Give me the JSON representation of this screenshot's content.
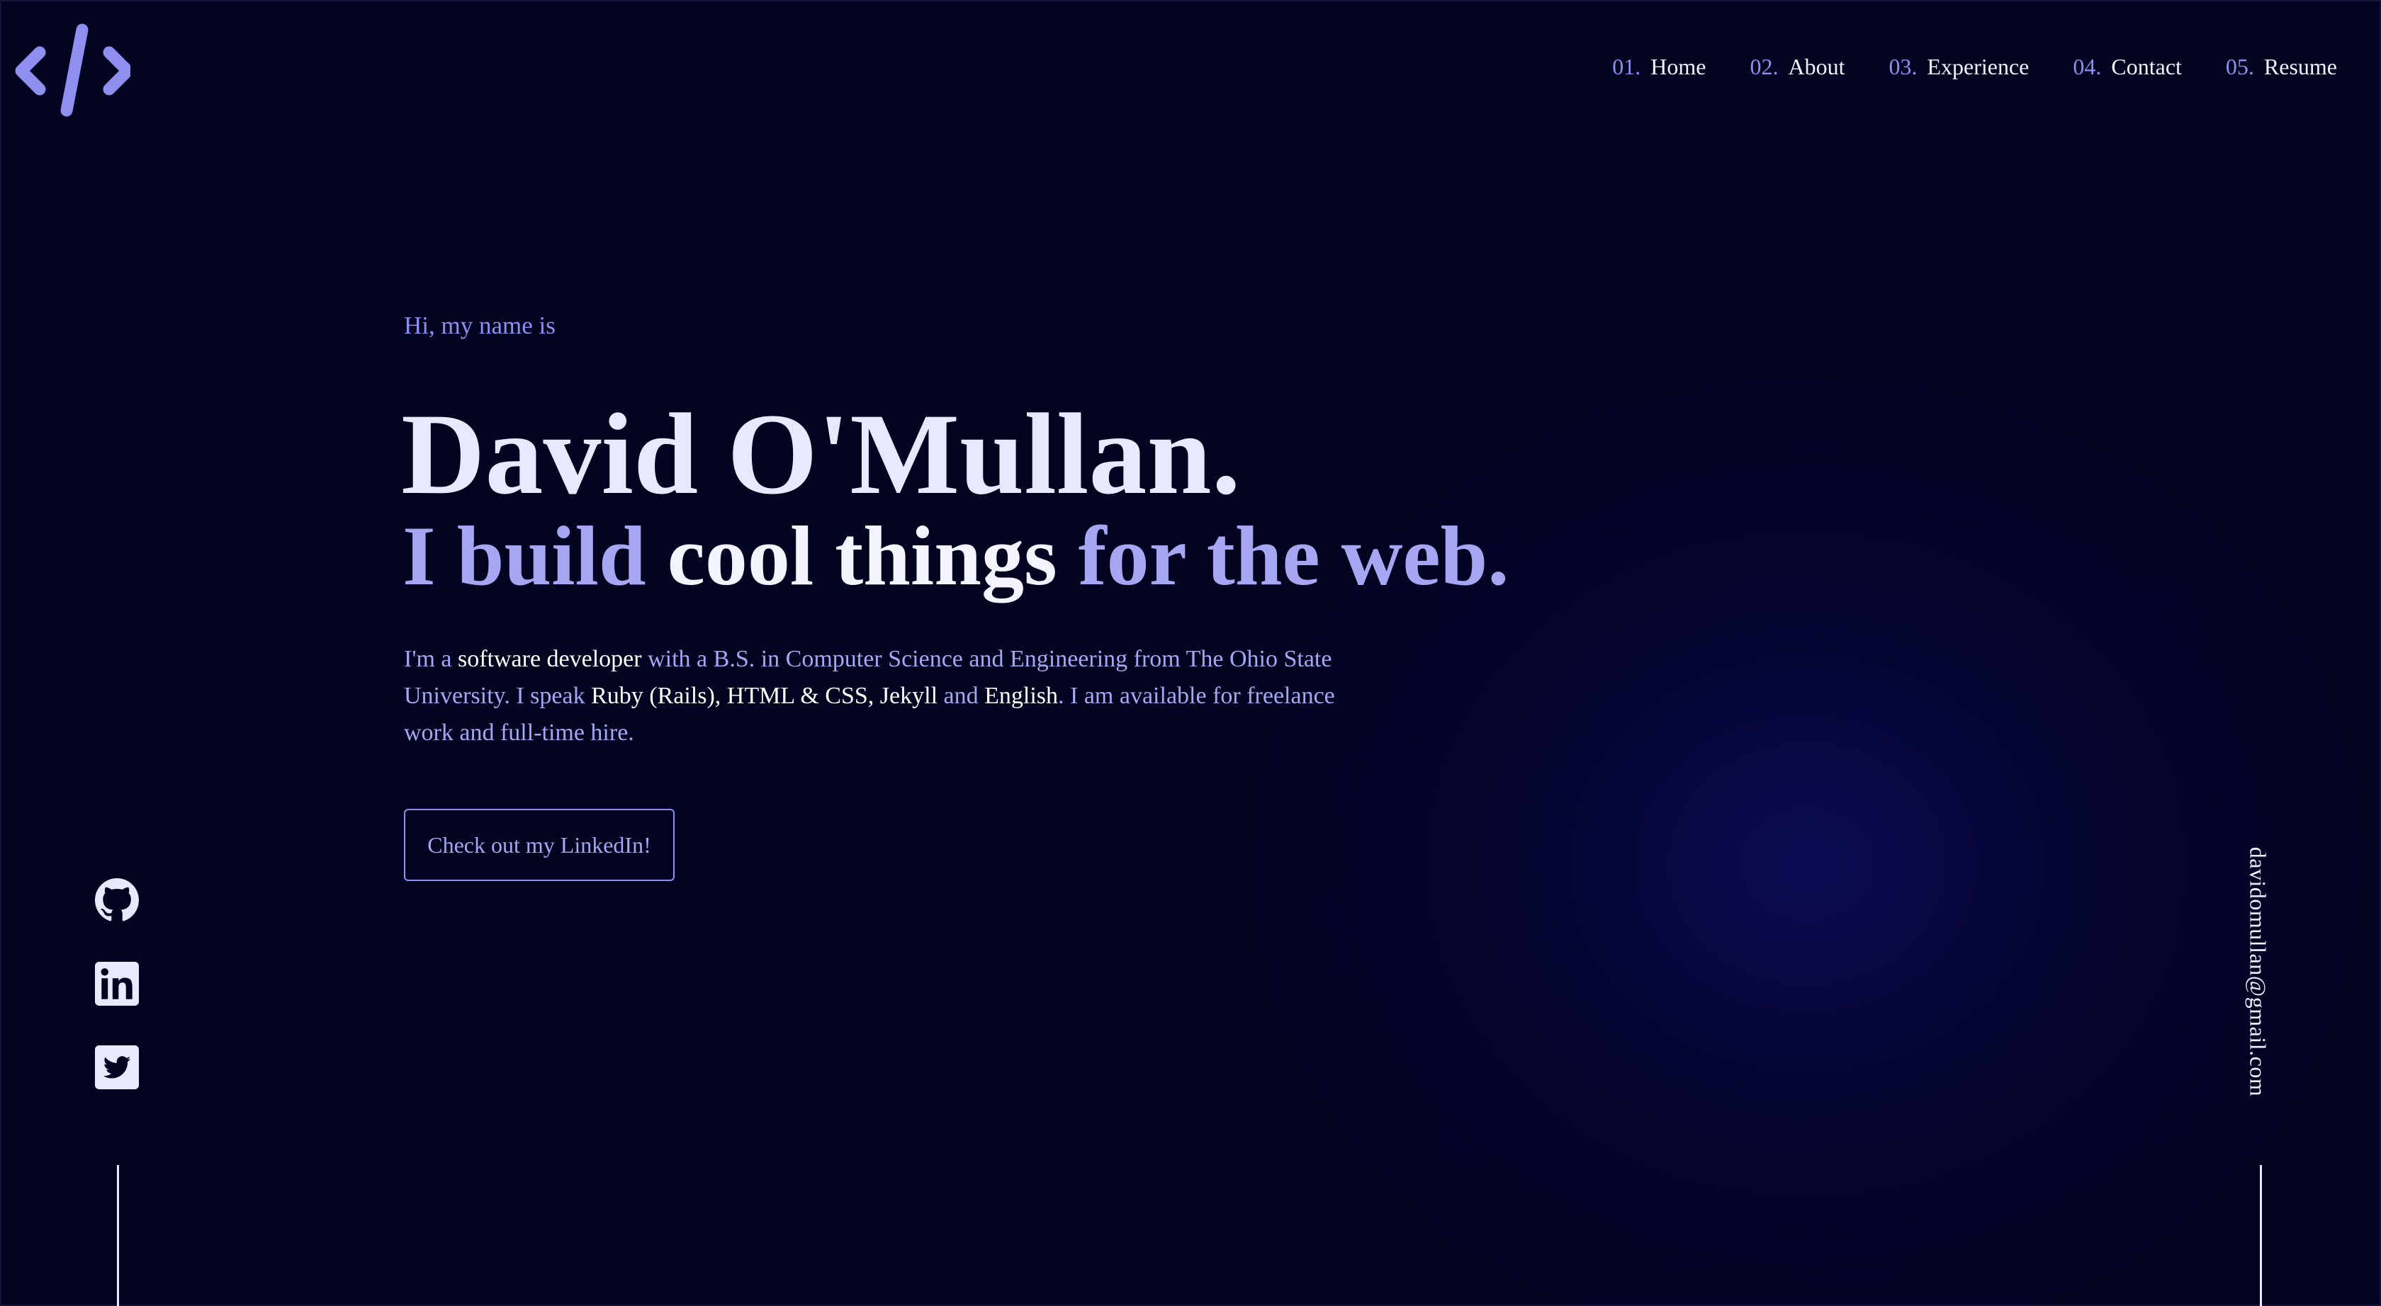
{
  "nav": {
    "items": [
      {
        "num": "01.",
        "label": "Home"
      },
      {
        "num": "02.",
        "label": "About"
      },
      {
        "num": "03.",
        "label": "Experience"
      },
      {
        "num": "04.",
        "label": "Contact"
      },
      {
        "num": "05.",
        "label": "Resume"
      }
    ]
  },
  "hero": {
    "greeting": "Hi, my name is",
    "name": "David O'Mullan.",
    "tagline": {
      "part1": "I build ",
      "part2": "cool things",
      "part3": " for the web."
    },
    "intro": {
      "s1": "I'm a ",
      "s2": "software developer",
      "s3": " with a B.S. in Computer Science and Engineering from The Ohio State University. I speak ",
      "s4": "Ruby (Rails), HTML & CSS, Jekyll",
      "s5": " and ",
      "s6": "English",
      "s7": ". I am available for freelance work and full-time hire."
    },
    "cta_label": "Check out my LinkedIn!"
  },
  "social": {
    "icons": [
      "github-icon",
      "linkedin-icon",
      "twitter-icon"
    ]
  },
  "email": "davidomullan@gmail.com",
  "colors": {
    "background": "#020221",
    "accent": "#8f8ff0",
    "accent_light": "#a6a6f2",
    "text": "#e8e8ff"
  }
}
